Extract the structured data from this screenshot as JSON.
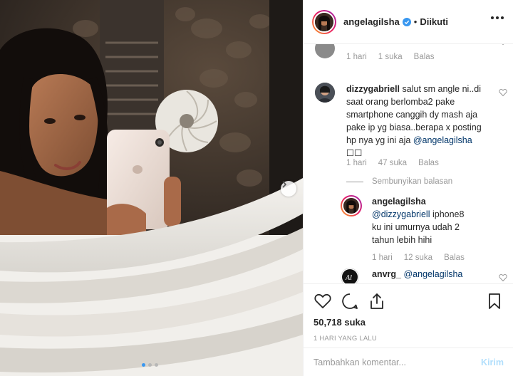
{
  "colors": {
    "accent": "#3897f0",
    "mention": "#003569",
    "muted": "#999999",
    "post_disabled": "#b2dffc"
  },
  "photo": {
    "carousel_dots": 3,
    "active_dot": 0,
    "next_icon": "chevron-right-icon"
  },
  "header": {
    "username": "angelagilsha",
    "verified_icon": "verified-badge-icon",
    "separator": "•",
    "follow_status": "Diikuti",
    "more_icon": "more-options-icon"
  },
  "comments": {
    "first": {
      "time": "1 hari",
      "likes": "1 suka",
      "reply": "Balas"
    },
    "second": {
      "username": "dizzygabriell",
      "text": "salut sm angle ni..di saat orang berlomba2 pake smartphone canggih dy mash aja pake ip yg biasa..berapa x posting hp nya yg ini aja",
      "mention": "@angelagilsha",
      "emoji": "☐☐",
      "time": "1 hari",
      "likes": "47 suka",
      "reply": "Balas"
    },
    "hide_replies": "Sembunyikan balasan",
    "reply1": {
      "username": "angelagilsha",
      "mention": "@dizzygabriell",
      "text": "iphone8 ku ini umurnya udah 2 tahun lebih hihi",
      "time": "1 hari",
      "likes": "12 suka",
      "reply": "Balas"
    },
    "reply2": {
      "username": "anvrg_",
      "mention": "@angelagilsha"
    }
  },
  "actions": {
    "like_icon": "heart-icon",
    "comment_icon": "comment-icon",
    "share_icon": "share-icon",
    "save_icon": "bookmark-icon",
    "likes_count": "50,718 suka",
    "post_time": "1 HARI YANG LALU"
  },
  "add_comment": {
    "placeholder": "Tambahkan komentar...",
    "post_label": "Kirim"
  }
}
